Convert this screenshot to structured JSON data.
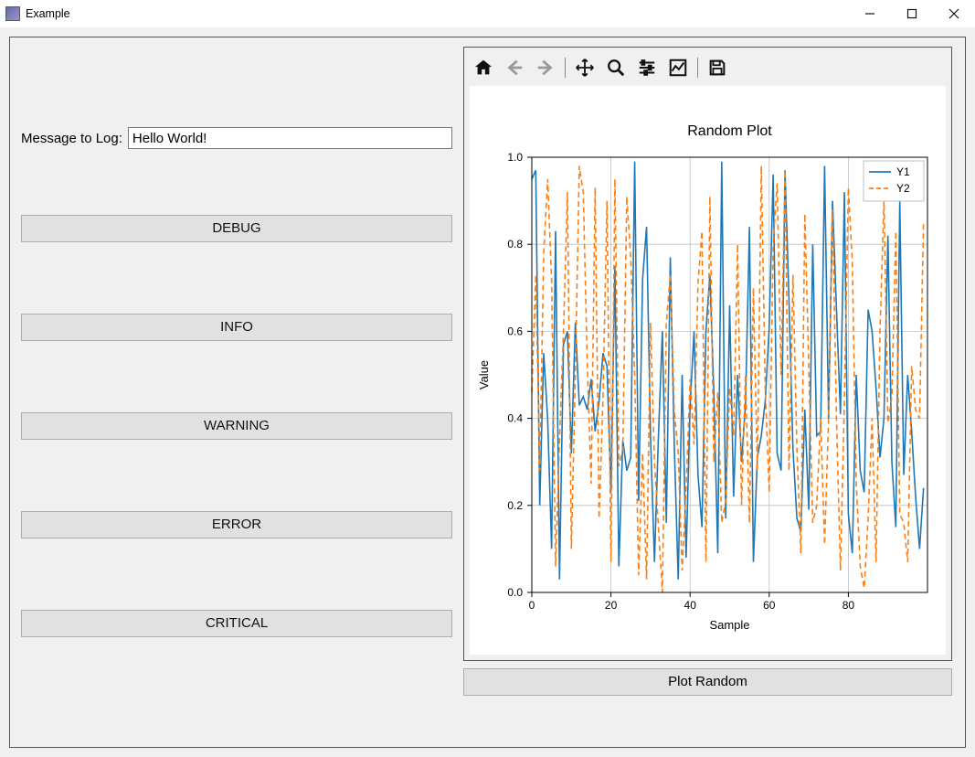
{
  "window": {
    "title": "Example"
  },
  "left": {
    "message_label": "Message to Log:",
    "message_value": "Hello World!",
    "buttons": {
      "debug": "DEBUG",
      "info": "INFO",
      "warning": "WARNING",
      "error": "ERROR",
      "critical": "CRITICAL"
    }
  },
  "right": {
    "plot_button": "Plot Random"
  },
  "toolbar": {
    "icons": {
      "home": "home-icon",
      "back": "back-icon",
      "forward": "forward-icon",
      "pan": "pan-icon",
      "zoom": "zoom-icon",
      "configure": "configure-icon",
      "edit": "edit-icon",
      "save": "save-icon"
    }
  },
  "chart_data": {
    "type": "line",
    "title": "Random Plot",
    "xlabel": "Sample",
    "ylabel": "Value",
    "xlim": [
      0,
      100
    ],
    "ylim": [
      0.0,
      1.0
    ],
    "xticks": [
      0,
      20,
      40,
      60,
      80
    ],
    "yticks": [
      0.0,
      0.2,
      0.4,
      0.6,
      0.8,
      1.0
    ],
    "series": [
      {
        "name": "Y1",
        "style": "solid",
        "color": "#1f77b4",
        "values": [
          0.95,
          0.97,
          0.2,
          0.55,
          0.4,
          0.1,
          0.83,
          0.03,
          0.57,
          0.6,
          0.32,
          0.62,
          0.43,
          0.45,
          0.42,
          0.49,
          0.37,
          0.44,
          0.55,
          0.52,
          0.23,
          0.75,
          0.06,
          0.35,
          0.28,
          0.31,
          0.99,
          0.21,
          0.72,
          0.84,
          0.36,
          0.07,
          0.36,
          0.6,
          0.16,
          0.77,
          0.34,
          0.03,
          0.5,
          0.08,
          0.43,
          0.6,
          0.27,
          0.15,
          0.6,
          0.73,
          0.46,
          0.09,
          0.99,
          0.17,
          0.66,
          0.22,
          0.5,
          0.3,
          0.43,
          0.84,
          0.07,
          0.31,
          0.36,
          0.44,
          0.61,
          0.96,
          0.32,
          0.28,
          0.97,
          0.67,
          0.33,
          0.17,
          0.14,
          0.42,
          0.19,
          0.8,
          0.36,
          0.37,
          0.98,
          0.4,
          0.9,
          0.65,
          0.41,
          0.92,
          0.18,
          0.09,
          0.5,
          0.28,
          0.23,
          0.65,
          0.6,
          0.47,
          0.31,
          0.4,
          0.82,
          0.3,
          0.15,
          0.9,
          0.27,
          0.5,
          0.37,
          0.22,
          0.1,
          0.24
        ]
      },
      {
        "name": "Y2",
        "style": "dashed",
        "color": "#ff7f0e",
        "values": [
          0.46,
          0.73,
          0.28,
          0.78,
          0.95,
          0.72,
          0.06,
          0.35,
          0.6,
          0.92,
          0.1,
          0.5,
          0.98,
          0.92,
          0.53,
          0.25,
          0.93,
          0.17,
          0.45,
          0.9,
          0.07,
          0.95,
          0.29,
          0.33,
          0.91,
          0.77,
          0.5,
          0.04,
          0.32,
          0.03,
          0.62,
          0.3,
          0.15,
          0.0,
          0.62,
          0.73,
          0.42,
          0.32,
          0.05,
          0.24,
          0.49,
          0.34,
          0.71,
          0.83,
          0.07,
          0.91,
          0.3,
          0.46,
          0.16,
          0.21,
          0.47,
          0.36,
          0.8,
          0.2,
          0.5,
          0.16,
          0.7,
          0.28,
          0.98,
          0.47,
          0.23,
          0.8,
          0.94,
          0.5,
          0.97,
          0.28,
          0.73,
          0.33,
          0.09,
          0.87,
          0.52,
          0.16,
          0.2,
          0.4,
          0.11,
          0.4,
          0.88,
          0.4,
          0.05,
          0.44,
          0.93,
          0.76,
          0.25,
          0.06,
          0.01,
          0.17,
          0.4,
          0.07,
          0.6,
          0.9,
          0.39,
          0.45,
          0.83,
          0.18,
          0.16,
          0.07,
          0.52,
          0.42,
          0.4,
          0.85
        ]
      }
    ],
    "legend": {
      "position": "upper right",
      "entries": [
        "Y1",
        "Y2"
      ]
    }
  }
}
